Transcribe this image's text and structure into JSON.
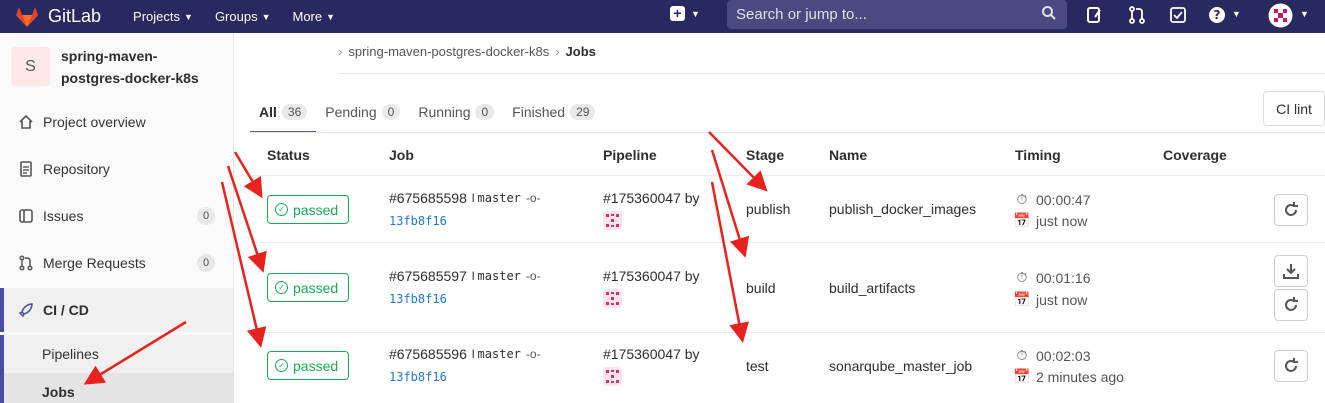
{
  "topnav": {
    "brand": "GitLab",
    "links": [
      {
        "label": "Projects"
      },
      {
        "label": "Groups"
      },
      {
        "label": "More"
      }
    ],
    "search_placeholder": "Search or jump to..."
  },
  "sidebar": {
    "project_avatar_letter": "S",
    "project_name_line1": "spring-maven-",
    "project_name_line2": "postgres-docker-k8s",
    "items": [
      {
        "label": "Project overview",
        "icon": "home-icon"
      },
      {
        "label": "Repository",
        "icon": "repository-icon"
      },
      {
        "label": "Issues",
        "icon": "issues-icon",
        "count": "0"
      },
      {
        "label": "Merge Requests",
        "icon": "merge-request-icon",
        "count": "0"
      },
      {
        "label": "CI / CD",
        "icon": "rocket-icon"
      }
    ],
    "subitems": [
      {
        "label": "Pipelines"
      },
      {
        "label": "Jobs"
      }
    ]
  },
  "breadcrumb": {
    "project": "spring-maven-postgres-docker-k8s",
    "current": "Jobs"
  },
  "tabs": [
    {
      "label": "All",
      "count": "36"
    },
    {
      "label": "Pending",
      "count": "0"
    },
    {
      "label": "Running",
      "count": "0"
    },
    {
      "label": "Finished",
      "count": "29"
    }
  ],
  "ci_lint_label": "CI lint",
  "columns": [
    "Status",
    "Job",
    "Pipeline",
    "Stage",
    "Name",
    "Timing",
    "Coverage"
  ],
  "jobs": [
    {
      "status": "passed",
      "id": "#675685598",
      "branch": "master",
      "sha": "13fb8f16",
      "pipeline": "#175360047 by",
      "stage": "publish",
      "name": "publish_docker_images",
      "duration": "00:00:47",
      "finished": "just now"
    },
    {
      "status": "passed",
      "id": "#675685597",
      "branch": "master",
      "sha": "13fb8f16",
      "pipeline": "#175360047 by",
      "stage": "build",
      "name": "build_artifacts",
      "duration": "00:01:16",
      "finished": "just now"
    },
    {
      "status": "passed",
      "id": "#675685596",
      "branch": "master",
      "sha": "13fb8f16",
      "pipeline": "#175360047 by",
      "stage": "test",
      "name": "sonarqube_master_job",
      "duration": "00:02:03",
      "finished": "2 minutes ago"
    }
  ],
  "colors": {
    "nav_bg": "#292961",
    "success": "#1aaa55",
    "link": "#1f78d1",
    "annotation_arrow": "#e8231d"
  }
}
